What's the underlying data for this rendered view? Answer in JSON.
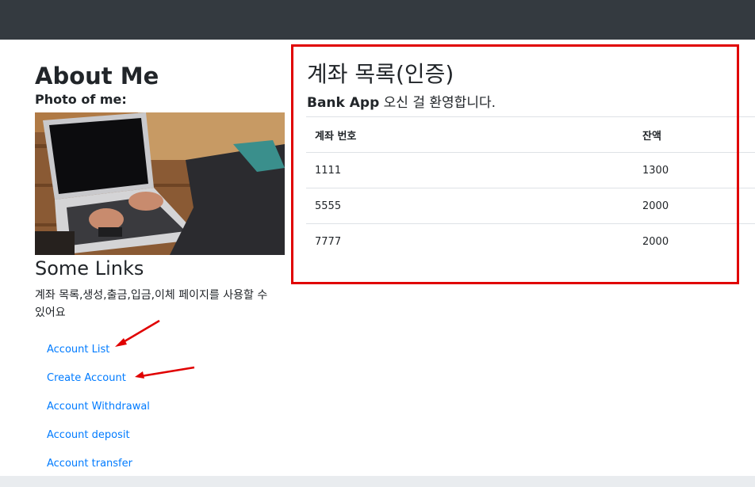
{
  "sidebar": {
    "about_title": "About Me",
    "photo_label": "Photo of me:",
    "links_title": "Some Links",
    "links_description": "계좌 목록,생성,출금,입금,이체 페이지를 사용할 수 있어요",
    "links": [
      {
        "label": "Account List"
      },
      {
        "label": "Create Account"
      },
      {
        "label": "Account Withdrawal"
      },
      {
        "label": "Account deposit"
      },
      {
        "label": "Account transfer"
      }
    ]
  },
  "main": {
    "title": "계좌 목록(인증)",
    "welcome_user": "Bank App",
    "welcome_rest": " 오신 걸 환영합니다.",
    "table": {
      "headers": [
        "계좌 번호",
        "잔액"
      ],
      "rows": [
        {
          "number": "1111",
          "balance": "1300"
        },
        {
          "number": "5555",
          "balance": "2000"
        },
        {
          "number": "7777",
          "balance": "2000"
        }
      ]
    }
  },
  "colors": {
    "navbar": "#343a40",
    "link": "#007bff",
    "annotation_red": "#e00000"
  }
}
